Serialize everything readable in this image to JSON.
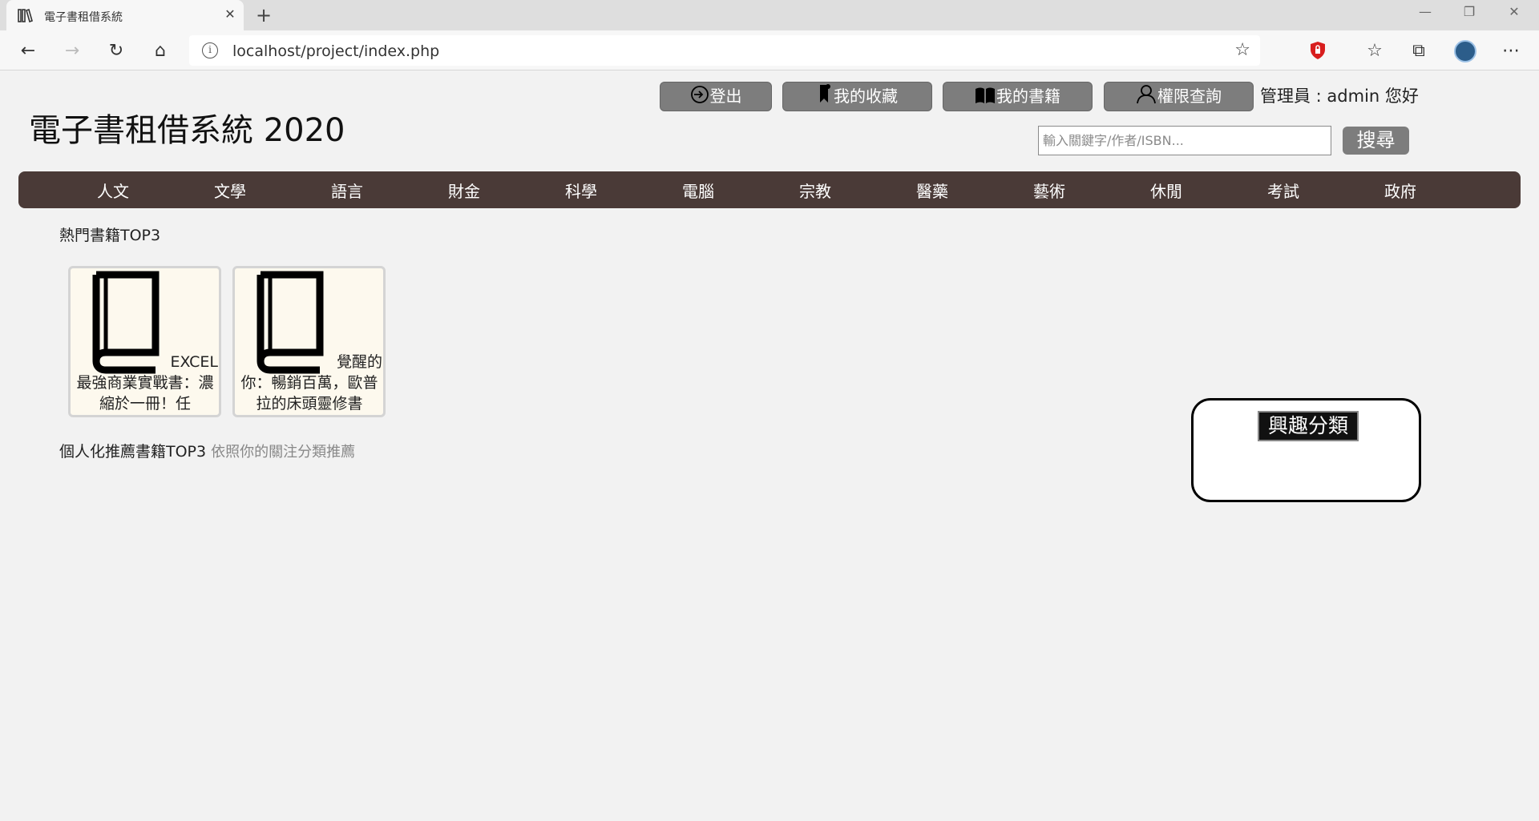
{
  "browser": {
    "tab_title": "電子書租借系統",
    "url": "localhost/project/index.php"
  },
  "site": {
    "title": "電子書租借系統 2020"
  },
  "header": {
    "logout_label": "登出",
    "favorites_label": "我的收藏",
    "my_books_label": "我的書籍",
    "permission_label": "權限查詢",
    "greeting": "管理員 : admin 您好"
  },
  "search": {
    "placeholder": "輸入關鍵字/作者/ISBN...",
    "button_label": "搜尋"
  },
  "categories": [
    "人文",
    "文學",
    "語言",
    "財金",
    "科學",
    "電腦",
    "宗教",
    "醫藥",
    "藝術",
    "休閒",
    "考試",
    "政府"
  ],
  "popular": {
    "heading": "熱門書籍TOP3",
    "books": [
      {
        "title_first": "EXCEL",
        "title_rest": "最強商業實戰書：濃縮於一冊！任"
      },
      {
        "title_first": "覺醒的",
        "title_rest": "你：暢銷百萬，歐普拉的床頭靈修書"
      }
    ]
  },
  "recommend": {
    "heading": "個人化推薦書籍TOP3",
    "subheading": "依照你的關注分類推薦"
  },
  "interest": {
    "title": "興趣分類"
  },
  "icons": [
    "library-icon",
    "close-icon",
    "plus-icon",
    "back-icon",
    "forward-icon",
    "refresh-icon",
    "home-icon",
    "info-icon",
    "star-icon",
    "shield-icon",
    "favorites-icon",
    "collections-icon",
    "profile-icon",
    "more-icon",
    "logout-icon",
    "bookmark-icon",
    "open-book-icon",
    "user-icon",
    "book-icon"
  ],
  "colors": {
    "nav_bg": "#4a3a37",
    "button_bg": "#7d7d7d",
    "card_bg": "#fdf9ee",
    "page_bg": "#f2f2f2"
  }
}
